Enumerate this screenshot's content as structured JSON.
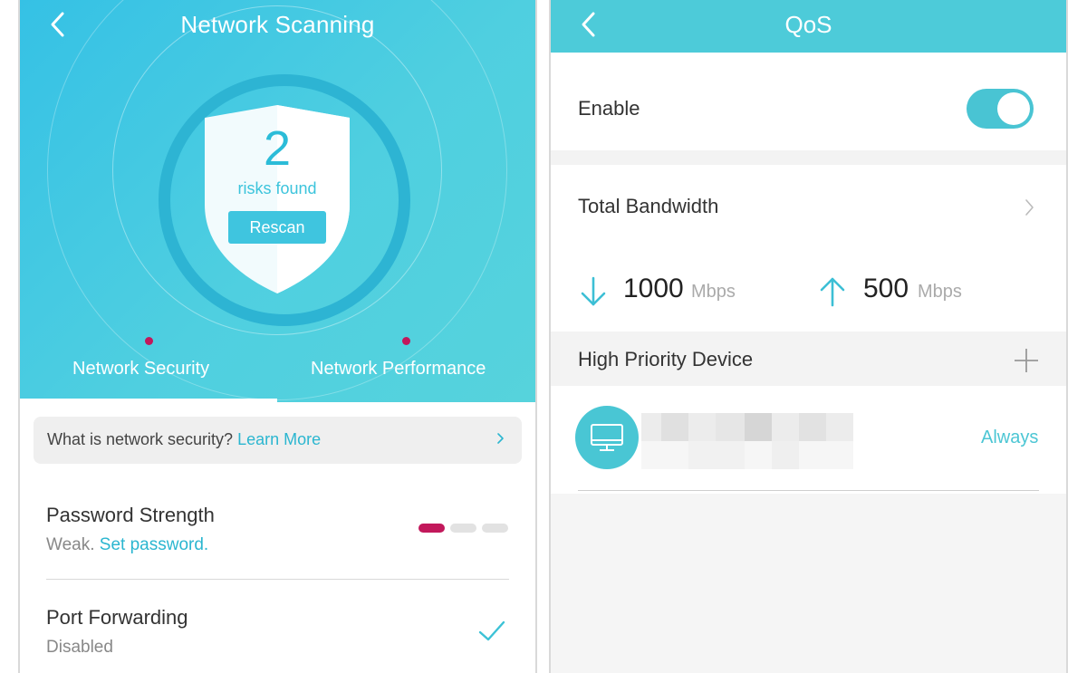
{
  "left_screen": {
    "title": "Network Scanning",
    "risk_count": "2",
    "risk_label": "risks found",
    "rescan_label": "Rescan",
    "tabs": [
      {
        "label": "Network Security",
        "active": true
      },
      {
        "label": "Network Performance",
        "active": false
      }
    ],
    "info": {
      "question": "What is network security?",
      "link": "Learn More"
    },
    "rows": [
      {
        "title": "Password Strength",
        "status": "Weak.",
        "action": "Set password.",
        "strength_level": 1,
        "strength_max": 3
      },
      {
        "title": "Port Forwarding",
        "status": "Disabled"
      }
    ]
  },
  "right_screen": {
    "title": "QoS",
    "enable_label": "Enable",
    "enable_on": true,
    "total_bandwidth_label": "Total Bandwidth",
    "download": {
      "value": "1000",
      "unit": "Mbps"
    },
    "upload": {
      "value": "500",
      "unit": "Mbps"
    },
    "high_priority_label": "High Priority Device",
    "device": {
      "icon": "monitor-icon",
      "schedule": "Always"
    }
  },
  "colors": {
    "accent": "#4dcbd9",
    "link": "#2bb6d0",
    "warning": "#c2185b"
  }
}
